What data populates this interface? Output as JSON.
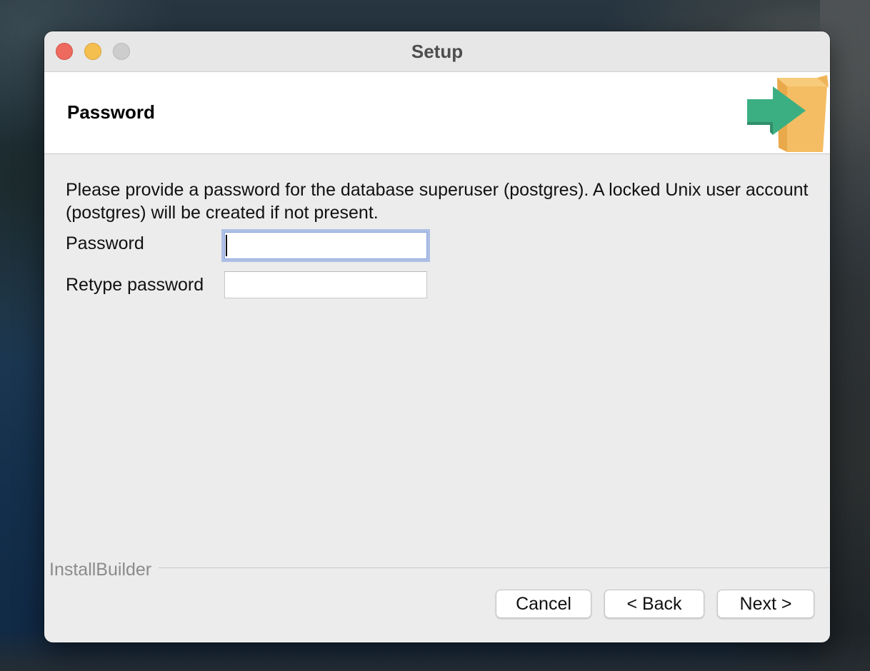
{
  "window": {
    "title": "Setup"
  },
  "header": {
    "title": "Password",
    "logo_icon": "installer-box-arrow-icon"
  },
  "body": {
    "description": "Please provide a password for the database superuser (postgres). A locked Unix user account (postgres) will be created if not present.",
    "fields": [
      {
        "label": "Password",
        "value": "",
        "focused": true
      },
      {
        "label": "Retype password",
        "value": "",
        "focused": false
      }
    ]
  },
  "footer": {
    "brand": "InstallBuilder",
    "buttons": {
      "cancel": "Cancel",
      "back": "< Back",
      "next": "Next >"
    }
  },
  "colors": {
    "close": "#ee6a5f",
    "minimize": "#f5bf4f",
    "zoom": "#cdcdcd",
    "focus_ring": "#aebfe6",
    "logo_box": "#f4bd63",
    "logo_arrow": "#3caf82"
  }
}
